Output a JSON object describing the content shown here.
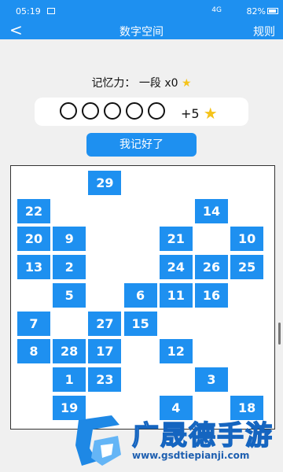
{
  "status": {
    "time": "05:19",
    "signal": "4G",
    "battery": "82%"
  },
  "nav": {
    "back_icon": "back-arrow-icon",
    "title": "数字空间",
    "rules": "规则"
  },
  "memory": {
    "label": "记忆力：",
    "value": "一段 x0"
  },
  "answer": {
    "circles": 5,
    "bonus": "+5"
  },
  "button": "我记好了",
  "board": {
    "tiles": [
      {
        "n": "29",
        "r": 0,
        "c": 2
      },
      {
        "n": "22",
        "r": 1,
        "c": 0
      },
      {
        "n": "14",
        "r": 1,
        "c": 5
      },
      {
        "n": "20",
        "r": 2,
        "c": 0
      },
      {
        "n": "9",
        "r": 2,
        "c": 1
      },
      {
        "n": "21",
        "r": 2,
        "c": 4
      },
      {
        "n": "10",
        "r": 2,
        "c": 6
      },
      {
        "n": "13",
        "r": 3,
        "c": 0
      },
      {
        "n": "2",
        "r": 3,
        "c": 1
      },
      {
        "n": "24",
        "r": 3,
        "c": 4
      },
      {
        "n": "26",
        "r": 3,
        "c": 5
      },
      {
        "n": "25",
        "r": 3,
        "c": 6
      },
      {
        "n": "5",
        "r": 4,
        "c": 1
      },
      {
        "n": "6",
        "r": 4,
        "c": 3
      },
      {
        "n": "11",
        "r": 4,
        "c": 4
      },
      {
        "n": "16",
        "r": 4,
        "c": 5
      },
      {
        "n": "7",
        "r": 5,
        "c": 0
      },
      {
        "n": "27",
        "r": 5,
        "c": 2
      },
      {
        "n": "15",
        "r": 5,
        "c": 3
      },
      {
        "n": "8",
        "r": 6,
        "c": 0
      },
      {
        "n": "28",
        "r": 6,
        "c": 1
      },
      {
        "n": "17",
        "r": 6,
        "c": 2
      },
      {
        "n": "12",
        "r": 6,
        "c": 4
      },
      {
        "n": "1",
        "r": 7,
        "c": 1
      },
      {
        "n": "23",
        "r": 7,
        "c": 2
      },
      {
        "n": "3",
        "r": 7,
        "c": 5
      },
      {
        "n": "19",
        "r": 8,
        "c": 1
      },
      {
        "n": "4",
        "r": 8,
        "c": 4
      },
      {
        "n": "18",
        "r": 8,
        "c": 6
      }
    ]
  },
  "watermark": {
    "title": "广晟德手游",
    "url": "www.gsdtiepianji.com"
  }
}
